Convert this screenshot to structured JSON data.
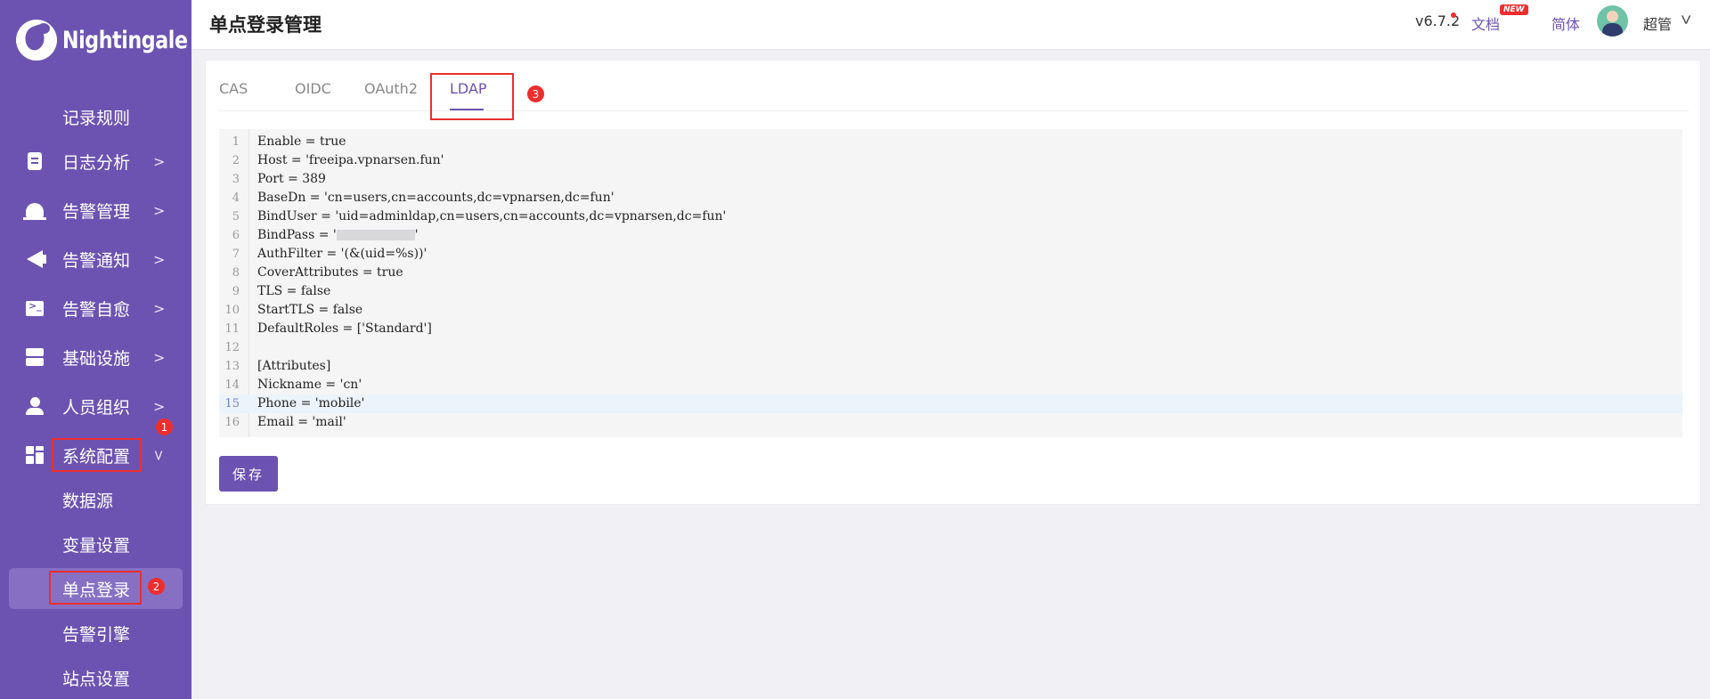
{
  "app": {
    "brand": "Nightingale"
  },
  "sidebar": {
    "items": [
      {
        "label": "记录规则"
      },
      {
        "label": "日志分析",
        "icon": "document-icon"
      },
      {
        "label": "告警管理",
        "icon": "bell-icon"
      },
      {
        "label": "告警通知",
        "icon": "megaphone-icon"
      },
      {
        "label": "告警自愈",
        "icon": "terminal-icon"
      },
      {
        "label": "基础设施",
        "icon": "server-icon"
      },
      {
        "label": "人员组织",
        "icon": "user-icon"
      },
      {
        "label": "系统配置",
        "icon": "grid-icon",
        "expanded": true
      },
      {
        "label": "数据源"
      },
      {
        "label": "变量设置"
      },
      {
        "label": "单点登录",
        "active": true
      },
      {
        "label": "告警引擎"
      },
      {
        "label": "站点设置"
      }
    ],
    "annotations": [
      "1",
      "2"
    ]
  },
  "header": {
    "title": "单点登录管理",
    "version": "v6.7.2",
    "docs_label": "文档",
    "new_badge": "NEW",
    "lang_label": "简体",
    "username": "超管"
  },
  "tabs": {
    "items": [
      {
        "label": "CAS"
      },
      {
        "label": "OIDC"
      },
      {
        "label": "OAuth2"
      },
      {
        "label": "LDAP",
        "active": true
      }
    ],
    "annotation": "3"
  },
  "editor": {
    "lines": [
      {
        "n": "1",
        "text": "Enable = true"
      },
      {
        "n": "2",
        "text": "Host = 'freeipa.vpnarsen.fun'"
      },
      {
        "n": "3",
        "text": "Port = 389"
      },
      {
        "n": "4",
        "text": "BaseDn = 'cn=users,cn=accounts,dc=vpnarsen,dc=fun'"
      },
      {
        "n": "5",
        "text": "BindUser = 'uid=adminldap,cn=users,cn=accounts,dc=vpnarsen,dc=fun'"
      },
      {
        "n": "6",
        "text_before": "BindPass = '",
        "text_after": "'"
      },
      {
        "n": "7",
        "text": "AuthFilter = '(&(uid=%s))'"
      },
      {
        "n": "8",
        "text": "CoverAttributes = true"
      },
      {
        "n": "9",
        "text": "TLS = false"
      },
      {
        "n": "10",
        "text": "StartTLS = false"
      },
      {
        "n": "11",
        "text": "DefaultRoles = ['Standard']"
      },
      {
        "n": "12",
        "text": ""
      },
      {
        "n": "13",
        "text": "[Attributes]"
      },
      {
        "n": "14",
        "text": "Nickname = 'cn'"
      },
      {
        "n": "15",
        "text": "Phone = 'mobile'"
      },
      {
        "n": "16",
        "text": "Email = 'mail'"
      }
    ],
    "highlighted_line": "15"
  },
  "actions": {
    "save_label": "保存"
  },
  "colors": {
    "accent": "#6c53b1",
    "annotation_red": "#ee2e2e"
  }
}
